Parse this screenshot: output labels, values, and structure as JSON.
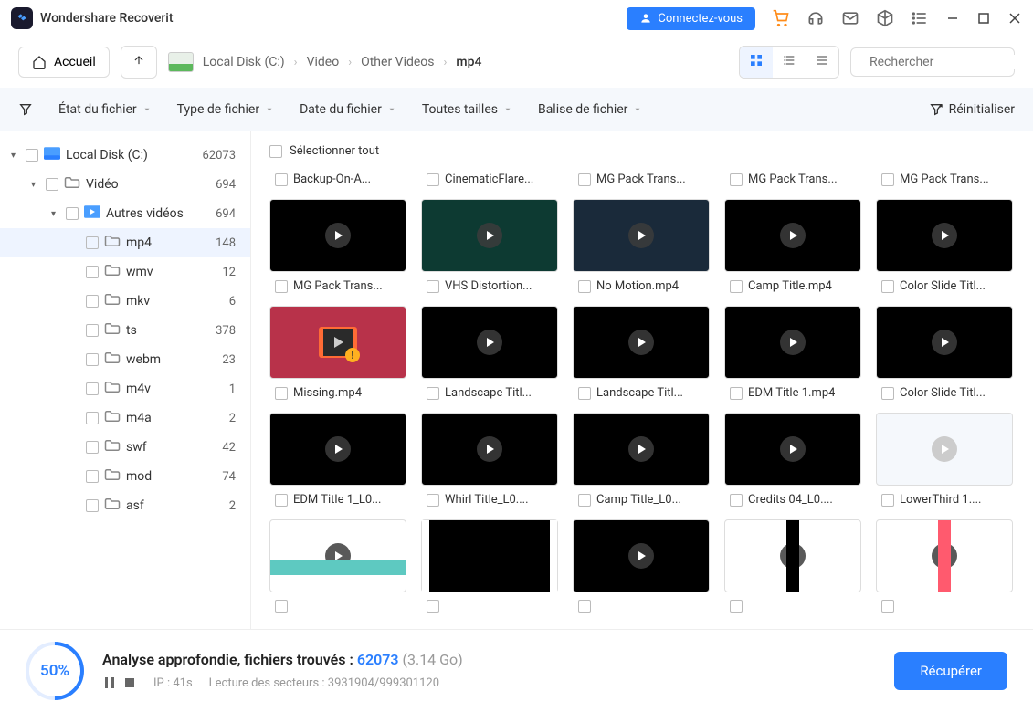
{
  "app_title": "Wondershare Recoverit",
  "connect_btn": "Connectez-vous",
  "home_btn": "Accueil",
  "breadcrumb": [
    "Local Disk (C:)",
    "Video",
    "Other Videos",
    "mp4"
  ],
  "search_placeholder": "Rechercher",
  "filters": {
    "state": "État du fichier",
    "type": "Type de fichier",
    "date": "Date du fichier",
    "size": "Toutes tailles",
    "tag": "Balise de fichier",
    "reset": "Réinitialiser"
  },
  "tree": [
    {
      "indent": 0,
      "toggle": "▾",
      "icon": "disk",
      "label": "Local Disk (C:)",
      "count": "62073"
    },
    {
      "indent": 1,
      "toggle": "▾",
      "icon": "folder",
      "label": "Vidéo",
      "count": "694"
    },
    {
      "indent": 2,
      "toggle": "▾",
      "icon": "video",
      "label": "Autres vidéos",
      "count": "694"
    },
    {
      "indent": 3,
      "toggle": "",
      "icon": "folder",
      "label": "mp4",
      "count": "148",
      "selected": true
    },
    {
      "indent": 3,
      "toggle": "",
      "icon": "folder",
      "label": "wmv",
      "count": "12"
    },
    {
      "indent": 3,
      "toggle": "",
      "icon": "folder",
      "label": "mkv",
      "count": "6"
    },
    {
      "indent": 3,
      "toggle": "",
      "icon": "folder",
      "label": "ts",
      "count": "378"
    },
    {
      "indent": 3,
      "toggle": "",
      "icon": "folder",
      "label": "webm",
      "count": "23"
    },
    {
      "indent": 3,
      "toggle": "",
      "icon": "folder",
      "label": "m4v",
      "count": "1"
    },
    {
      "indent": 3,
      "toggle": "",
      "icon": "folder",
      "label": "m4a",
      "count": "2"
    },
    {
      "indent": 3,
      "toggle": "",
      "icon": "folder",
      "label": "swf",
      "count": "42"
    },
    {
      "indent": 3,
      "toggle": "",
      "icon": "folder",
      "label": "mod",
      "count": "74"
    },
    {
      "indent": 3,
      "toggle": "",
      "icon": "folder",
      "label": "asf",
      "count": "2"
    }
  ],
  "select_all": "Sélectionner tout",
  "grid": [
    [
      {
        "name": "Backup-On-A...",
        "nothumb": true
      },
      {
        "name": "CinematicFlare...",
        "nothumb": true
      },
      {
        "name": "MG Pack Trans...",
        "nothumb": true
      },
      {
        "name": "MG Pack Trans...",
        "nothumb": true
      },
      {
        "name": "MG Pack Trans...",
        "nothumb": true
      }
    ],
    [
      {
        "name": "MG Pack Trans...",
        "bg": "#000"
      },
      {
        "name": "VHS Distortion...",
        "bg": "#0d3a32"
      },
      {
        "name": "No Motion.mp4",
        "bg": "#1a2a3a"
      },
      {
        "name": "Camp Title.mp4",
        "bg": "#000"
      },
      {
        "name": "Color Slide Titl...",
        "bg": "#000"
      }
    ],
    [
      {
        "name": "Missing.mp4",
        "bg": "#b8324a",
        "missing": true
      },
      {
        "name": "Landscape Titl...",
        "bg": "#000"
      },
      {
        "name": "Landscape Titl...",
        "bg": "#000"
      },
      {
        "name": "EDM Title 1.mp4",
        "bg": "#000"
      },
      {
        "name": "Color Slide Titl...",
        "bg": "#000"
      }
    ],
    [
      {
        "name": "EDM Title 1_L0...",
        "bg": "#000"
      },
      {
        "name": "Whirl Title_L0....",
        "bg": "#000"
      },
      {
        "name": "Camp Title_L0...",
        "bg": "#000"
      },
      {
        "name": "Credits 04_L0....",
        "bg": "#000"
      },
      {
        "name": "LowerThird 1....",
        "bg": "#f5f8fc",
        "light": true
      }
    ],
    [
      {
        "name": "",
        "bg": "#fff",
        "stripe": "#5ec9c1"
      },
      {
        "name": "",
        "bg": "#000",
        "partial": true
      },
      {
        "name": "",
        "bg": "#000"
      },
      {
        "name": "",
        "bg": "#fff",
        "vbar": "#000"
      },
      {
        "name": "",
        "bg": "#fff",
        "vbar": "#ff5a6e"
      }
    ]
  ],
  "footer": {
    "pct": "50%",
    "title_pre": "Analyse approfondie, fichiers trouvés : ",
    "count": "62073",
    "size": " (3.14 Go)",
    "ip": "IP : 41s",
    "sectors": "Lecture des secteurs : 3931904/999301120",
    "recover": "Récupérer"
  }
}
